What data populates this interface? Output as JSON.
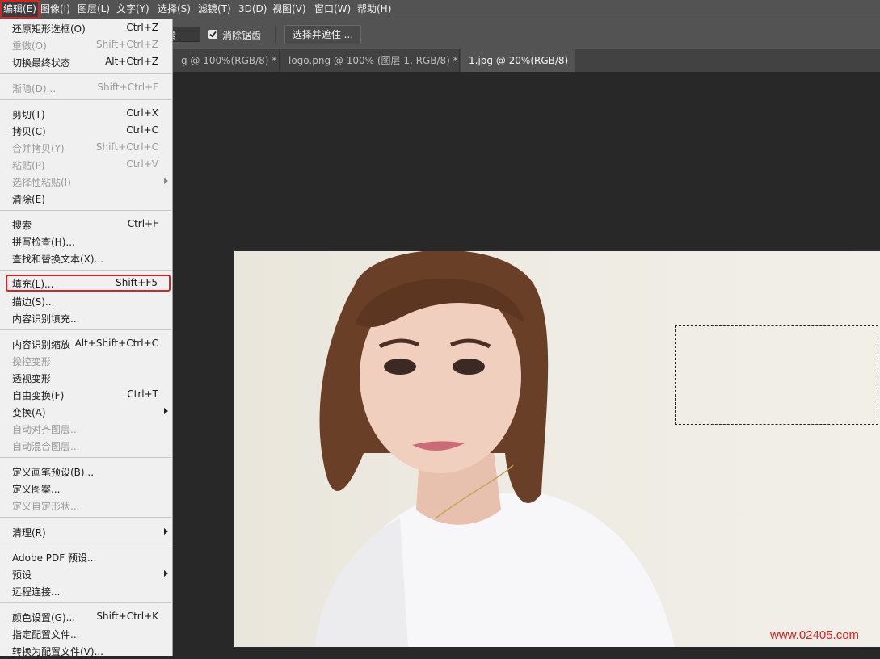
{
  "menubar": [
    "编辑(E)",
    "图像(I)",
    "图层(L)",
    "文字(Y)",
    "选择(S)",
    "滤镜(T)",
    "3D(D)",
    "视图(V)",
    "窗口(W)",
    "帮助(H)"
  ],
  "options": {
    "field_fragment": "素",
    "antialias_label": "消除锯齿",
    "antialias_checked": true,
    "select_mask_button": "选择并遮住 ..."
  },
  "tabs": [
    {
      "label": "g @ 100%(RGB/8) *",
      "close": "×"
    },
    {
      "label": "logo.png @ 100% (图层 1, RGB/8) *",
      "close": "×"
    },
    {
      "label": "1.jpg @ 20%(RGB/8)",
      "close": "×"
    }
  ],
  "edit_menu": {
    "groups": [
      [
        {
          "label": "还原矩形选框(O)",
          "shortcut": "Ctrl+Z",
          "enabled": true
        },
        {
          "label": "重做(O)",
          "shortcut": "Shift+Ctrl+Z",
          "enabled": false
        },
        {
          "label": "切换最终状态",
          "shortcut": "Alt+Ctrl+Z",
          "enabled": true
        }
      ],
      [
        {
          "label": "渐隐(D)...",
          "shortcut": "Shift+Ctrl+F",
          "enabled": false
        }
      ],
      [
        {
          "label": "剪切(T)",
          "shortcut": "Ctrl+X",
          "enabled": true
        },
        {
          "label": "拷贝(C)",
          "shortcut": "Ctrl+C",
          "enabled": true
        },
        {
          "label": "合并拷贝(Y)",
          "shortcut": "Shift+Ctrl+C",
          "enabled": false
        },
        {
          "label": "粘贴(P)",
          "shortcut": "Ctrl+V",
          "enabled": false
        },
        {
          "label": "选择性粘贴(I)",
          "shortcut": "",
          "enabled": false,
          "submenu": true
        },
        {
          "label": "清除(E)",
          "shortcut": "",
          "enabled": true
        }
      ],
      [
        {
          "label": "搜索",
          "shortcut": "Ctrl+F",
          "enabled": true
        },
        {
          "label": "拼写检查(H)...",
          "shortcut": "",
          "enabled": true
        },
        {
          "label": "查找和替换文本(X)...",
          "shortcut": "",
          "enabled": true
        }
      ],
      [
        {
          "label": "填充(L)...",
          "shortcut": "Shift+F5",
          "enabled": true,
          "highlighted": true
        },
        {
          "label": "描边(S)...",
          "shortcut": "",
          "enabled": true
        },
        {
          "label": "内容识别填充...",
          "shortcut": "",
          "enabled": true
        }
      ],
      [
        {
          "label": "内容识别缩放",
          "shortcut": "Alt+Shift+Ctrl+C",
          "enabled": true
        },
        {
          "label": "操控变形",
          "shortcut": "",
          "enabled": false
        },
        {
          "label": "透视变形",
          "shortcut": "",
          "enabled": true
        },
        {
          "label": "自由变换(F)",
          "shortcut": "Ctrl+T",
          "enabled": true
        },
        {
          "label": "变换(A)",
          "shortcut": "",
          "enabled": true,
          "submenu": true
        },
        {
          "label": "自动对齐图层...",
          "shortcut": "",
          "enabled": false
        },
        {
          "label": "自动混合图层...",
          "shortcut": "",
          "enabled": false
        }
      ],
      [
        {
          "label": "定义画笔预设(B)...",
          "shortcut": "",
          "enabled": true
        },
        {
          "label": "定义图案...",
          "shortcut": "",
          "enabled": true
        },
        {
          "label": "定义自定形状...",
          "shortcut": "",
          "enabled": false
        }
      ],
      [
        {
          "label": "清理(R)",
          "shortcut": "",
          "enabled": true,
          "submenu": true
        }
      ],
      [
        {
          "label": "Adobe PDF 预设...",
          "shortcut": "",
          "enabled": true
        },
        {
          "label": "预设",
          "shortcut": "",
          "enabled": true,
          "submenu": true
        },
        {
          "label": "远程连接...",
          "shortcut": "",
          "enabled": true
        }
      ],
      [
        {
          "label": "颜色设置(G)...",
          "shortcut": "Shift+Ctrl+K",
          "enabled": true
        },
        {
          "label": "指定配置文件...",
          "shortcut": "",
          "enabled": true
        },
        {
          "label": "转换为配置文件(V)...",
          "shortcut": "",
          "enabled": true
        }
      ]
    ]
  },
  "watermark": "www.02405.com",
  "colors": {
    "highlight": "#e02020",
    "menu_bg": "#f0f0f0",
    "workspace": "#282828"
  }
}
